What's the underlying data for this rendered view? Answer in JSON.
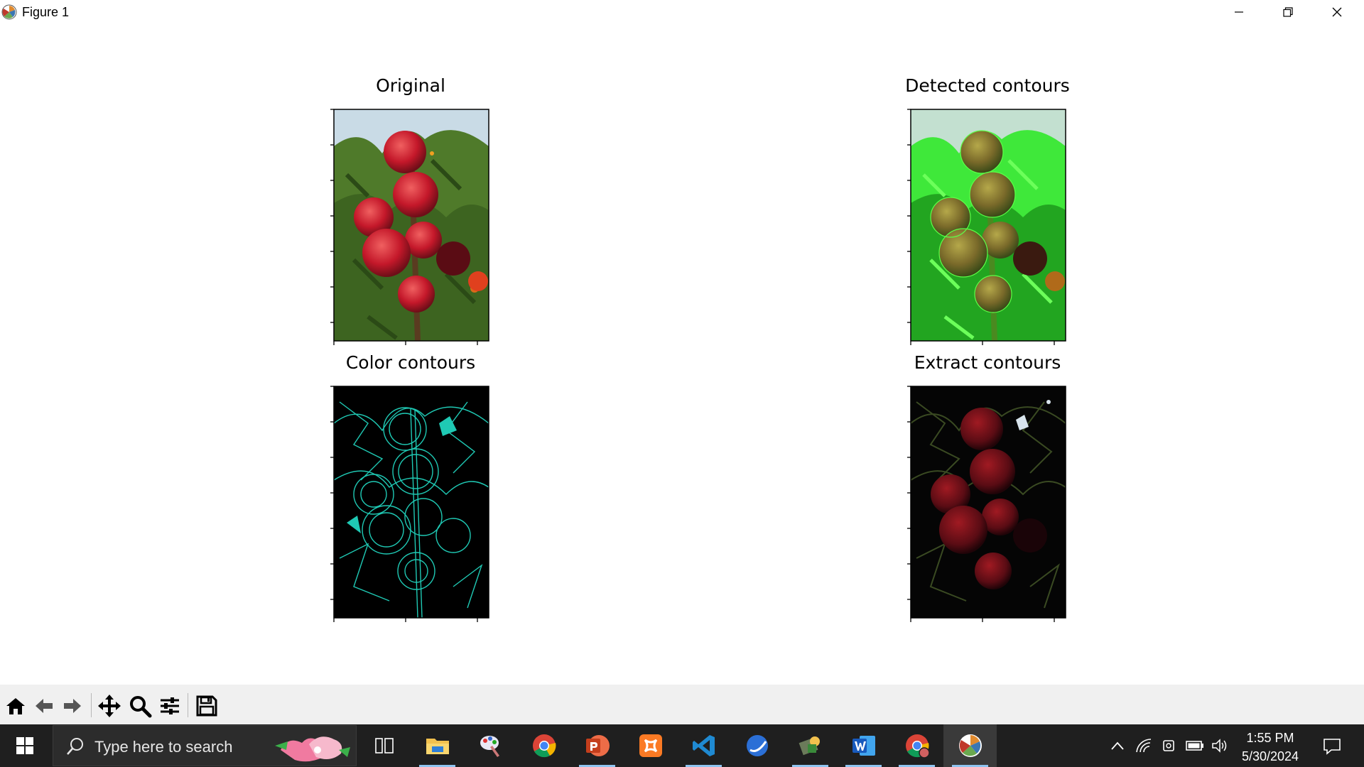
{
  "window": {
    "title": "Figure 1",
    "controls": {
      "minimize": "minimize-icon",
      "restore": "restore-icon",
      "close": "close-icon"
    }
  },
  "figure": {
    "subplots": [
      {
        "title": "Original",
        "image": "apples on branch, natural colors"
      },
      {
        "title": "Detected contours",
        "image": "apples with green contour overlay"
      },
      {
        "title": "Color contours",
        "image": "cyan edge contours on black"
      },
      {
        "title": "Extract contours",
        "image": "dark extracted apple regions on black"
      }
    ]
  },
  "toolbar": {
    "buttons": [
      "home-icon",
      "back-icon",
      "forward-icon",
      "pan-icon",
      "zoom-icon",
      "configure-subplots-icon",
      "save-icon"
    ]
  },
  "taskbar": {
    "search_placeholder": "Type here to search",
    "apps": [
      "task-view-icon",
      "file-explorer-icon",
      "paint-app-icon",
      "chrome-icon",
      "powerpoint-icon",
      "xampp-icon",
      "vscode-icon",
      "browser-icon",
      "tool-app-icon",
      "word-icon",
      "chrome-profile-icon",
      "python-figure-icon"
    ],
    "clock": {
      "time": "1:55 PM",
      "date": "5/30/2024"
    }
  },
  "colors": {
    "taskbar_bg": "#1f1f1f",
    "toolbar_bg": "#f0f0f0",
    "contour_cyan": "#1fc9b4",
    "contour_green": "#3fe83a"
  }
}
